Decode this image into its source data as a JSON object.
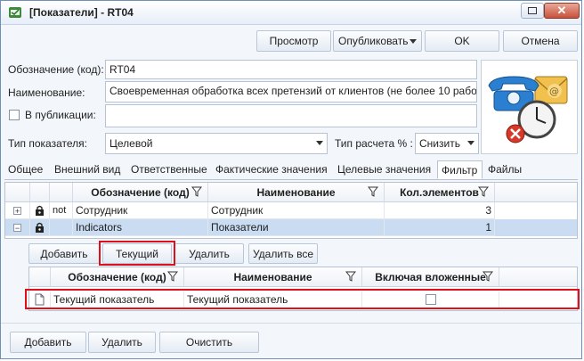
{
  "window": {
    "title": "[Показатели] - RT04"
  },
  "toolbar": {
    "preview_label": "Просмотр",
    "publish_label": "Опубликовать",
    "ok_label": "OK",
    "cancel_label": "Отмена"
  },
  "form": {
    "code_label": "Обозначение (код):",
    "code_value": "RT04",
    "name_label": "Наименование:",
    "name_value": "Своевременная обработка всех претензий от клиентов (не более 10 рабо",
    "publish_label": "В публикации:",
    "publish_value": "",
    "type_label": "Тип показателя:",
    "type_value": "Целевой",
    "calc_label": "Тип расчета % :",
    "calc_value": "Снизить"
  },
  "tabs": [
    "Общее",
    "Внешний вид",
    "Ответственные",
    "Фактические значения",
    "Целевые значения",
    "Фильтр",
    "Файлы"
  ],
  "active_tab": "Фильтр",
  "upper_grid": {
    "columns": [
      "Обозначение (код)",
      "Наименование",
      "Кол.элементов"
    ],
    "rows": [
      {
        "expander": "+",
        "prefix": "not",
        "code": "Сотрудник",
        "name": "Сотрудник",
        "count": "3"
      },
      {
        "expander": "−",
        "prefix": "",
        "code": "Indicators",
        "name": "Показатели",
        "count": "1"
      }
    ]
  },
  "lower_toolbar": {
    "add_label": "Добавить",
    "current_label": "Текущий",
    "delete_label": "Удалить",
    "delete_all_label": "Удалить все"
  },
  "lower_grid": {
    "columns": [
      "Обозначение (код)",
      "Наименование",
      "Включая вложенные"
    ],
    "rows": [
      {
        "code": "Текущий показатель",
        "name": "Текущий показатель",
        "nested": false
      }
    ]
  },
  "footer": {
    "add_label": "Добавить",
    "delete_label": "Удалить",
    "clear_label": "Очистить"
  },
  "colors": {
    "selected_row": "#c9dcf2",
    "highlight": "#e0101a",
    "accent": "#3d6aa8"
  }
}
